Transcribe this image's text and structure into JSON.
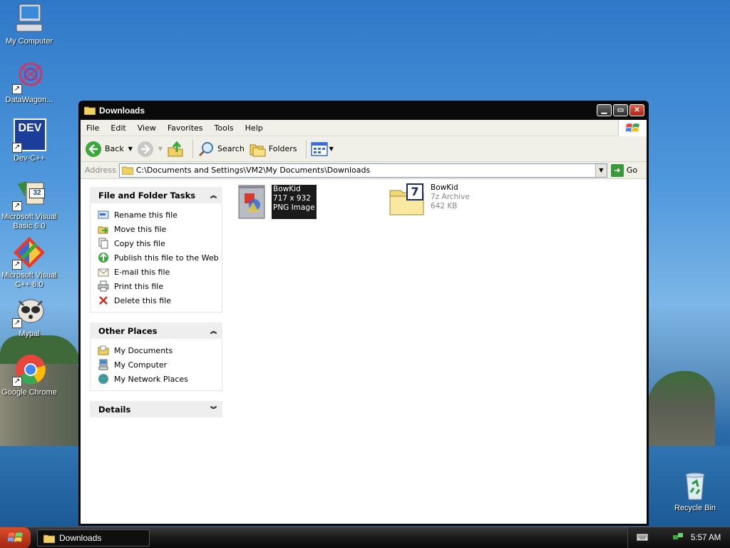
{
  "desktop": {
    "icons": [
      {
        "label": "My Computer",
        "name": "desktop-icon-my-computer"
      },
      {
        "label": "DataWagon...",
        "name": "desktop-icon-datawagon"
      },
      {
        "label": "Dev-C++",
        "name": "desktop-icon-dev-cpp"
      },
      {
        "label": "Microsoft Visual Basic 6.0",
        "name": "desktop-icon-visual-basic"
      },
      {
        "label": "Microsoft Visual C++ 6.0",
        "name": "desktop-icon-visual-cpp"
      },
      {
        "label": "Mypal",
        "name": "desktop-icon-mypal"
      },
      {
        "label": "Google Chrome",
        "name": "desktop-icon-google-chrome"
      },
      {
        "label": "Recycle Bin",
        "name": "desktop-icon-recycle-bin"
      }
    ],
    "dev_icon_text": "DEV",
    "vb_icon_text": "32"
  },
  "window": {
    "title": "Downloads",
    "menu": [
      "File",
      "Edit",
      "View",
      "Favorites",
      "Tools",
      "Help"
    ],
    "toolbar": {
      "back": "Back",
      "search": "Search",
      "folders": "Folders"
    },
    "address": {
      "label": "Address",
      "value": "C:\\Documents and Settings\\VM2\\My Documents\\Downloads",
      "go": "Go"
    },
    "tasks_panel": {
      "title": "File and Folder Tasks",
      "items": [
        "Rename this file",
        "Move this file",
        "Copy this file",
        "Publish this file to the Web",
        "E-mail this file",
        "Print this file",
        "Delete this file"
      ]
    },
    "places_panel": {
      "title": "Other Places",
      "items": [
        "My Documents",
        "My Computer",
        "My Network Places"
      ]
    },
    "details_panel": {
      "title": "Details"
    },
    "files": [
      {
        "name": "BowKid",
        "line2": "717 x 932",
        "line3": "PNG Image"
      },
      {
        "name": "BowKid",
        "line2": "7z Archive",
        "line3": "642 KB",
        "badge": "7"
      }
    ]
  },
  "taskbar": {
    "task": "Downloads",
    "clock": "5:57 AM"
  }
}
